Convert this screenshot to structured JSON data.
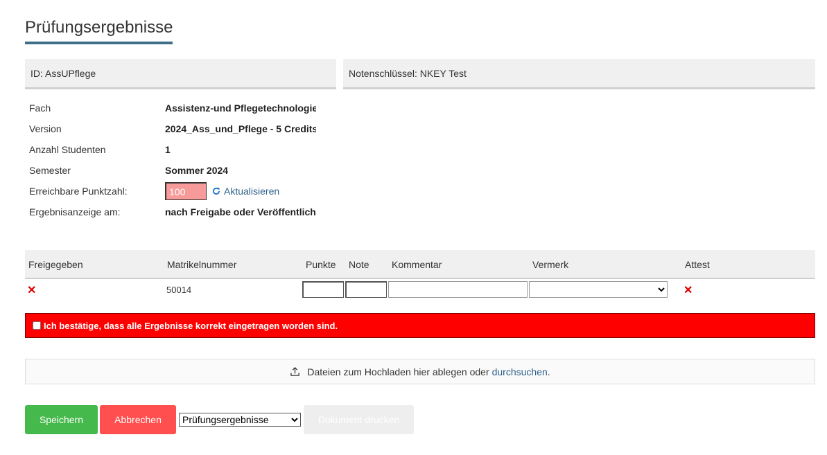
{
  "page": {
    "title": "Prüfungsergebnisse"
  },
  "panels": {
    "left": "ID: AssUPflege",
    "right": "Notenschlüssel: NKEY Test"
  },
  "info": {
    "fach_label": "Fach",
    "fach_value": "Assistenz-und Pflegetechnologie",
    "version_label": "Version",
    "version_value": "2024_Ass_und_Pflege - 5 Credits",
    "anzahl_label": "Anzahl Studenten",
    "anzahl_value": "1",
    "semester_label": "Semester",
    "semester_value": "Sommer 2024",
    "punkte_label": "Erreichbare Punktzahl:",
    "punkte_value": "100",
    "refresh_label": "Aktualisieren",
    "anzeige_label": "Ergebnisanzeige am:",
    "anzeige_value": "nach Freigabe oder Veröffentlich"
  },
  "table": {
    "headers": [
      "Freigegeben",
      "Matrikelnummer",
      "Punkte",
      "Note",
      "Kommentar",
      "Vermerk",
      "Attest"
    ],
    "rows": [
      {
        "matrikel": "50014"
      }
    ]
  },
  "confirm": {
    "label": "Ich bestätige, dass alle Ergebnisse korrekt eingetragen worden sind."
  },
  "dropzone": {
    "text": "Dateien zum Hochladen hier ablegen oder",
    "link": "durchsuchen",
    "suffix": "."
  },
  "actions": {
    "save": "Speichern",
    "cancel": "Abbrechen",
    "doc_select": "Prüfungsergebnisse",
    "print": "Dokument drucken"
  },
  "colors": {
    "accent": "#3f6f86",
    "save": "#46b94c",
    "cancel": "#ff4f4f",
    "confirm_bg": "#ff0000",
    "error_x": "#e00000",
    "link": "#2b5f8a"
  },
  "icons": {
    "refresh": "refresh-icon",
    "upload": "upload-icon",
    "status": "x-icon"
  }
}
